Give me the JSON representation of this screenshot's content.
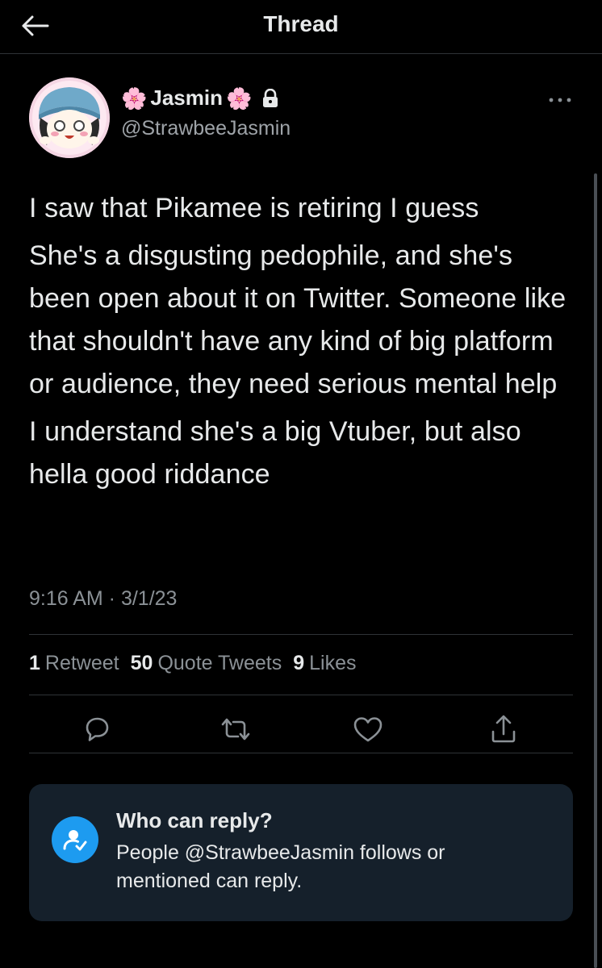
{
  "header": {
    "title": "Thread",
    "back_icon": "arrow-left-icon"
  },
  "author": {
    "flower_left": "🌸",
    "name": "Jasmin",
    "flower_right": "🌸",
    "handle": "@StrawbeeJasmin",
    "protected_icon": "lock-icon",
    "more_icon": "more-horizontal-icon"
  },
  "tweet": {
    "paragraphs": [
      "I saw that Pikamee is retiring I guess",
      "She's a disgusting pedophile, and she's been open about it on Twitter. Someone like that shouldn't have any kind of big platform or audience, they need serious mental help",
      "I understand she's a big Vtuber, but also hella good riddance"
    ],
    "timestamp": "9:16 AM · 3/1/23"
  },
  "stats": {
    "retweets_count": "1",
    "retweets_label": "Retweet",
    "quotes_count": "50",
    "quotes_label": "Quote Tweets",
    "likes_count": "9",
    "likes_label": "Likes"
  },
  "actions": {
    "reply_icon": "reply-icon",
    "retweet_icon": "retweet-icon",
    "like_icon": "heart-icon",
    "share_icon": "share-icon"
  },
  "who_can_reply": {
    "title": "Who can reply?",
    "description": "People @StrawbeeJasmin follows or mentioned can reply.",
    "icon": "user-check-icon"
  },
  "colors": {
    "background": "#000000",
    "text": "#e7e9ea",
    "secondary_text": "#8b9196",
    "divider": "#2f3336",
    "card": "#15202b",
    "accent": "#1d9bf0"
  }
}
